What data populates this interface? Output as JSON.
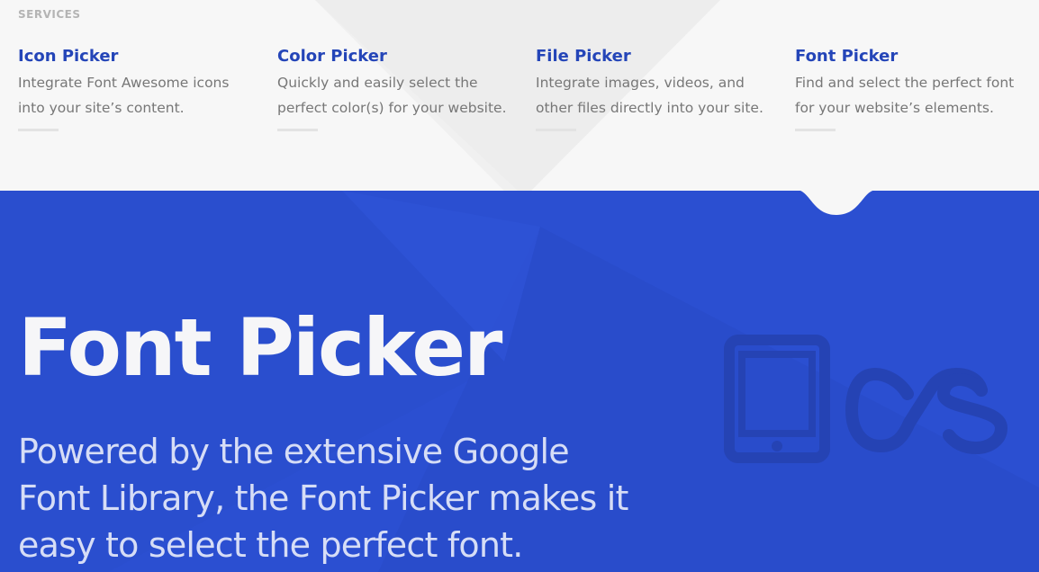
{
  "services": {
    "label": "SERVICES",
    "items": [
      {
        "title": "Icon Picker",
        "description": "Integrate Font Awesome icons into your site’s content."
      },
      {
        "title": "Color Picker",
        "description": "Quickly and easily select the perfect color(s) for your website."
      },
      {
        "title": "File Picker",
        "description": "Integrate images, videos, and other files directly into your site."
      },
      {
        "title": "Font Picker",
        "description": "Find and select the perfect font for your website’s elements."
      }
    ],
    "active_item": "Font Picker"
  },
  "hero": {
    "title": "Font Picker",
    "description": "Powered by the extensive Google Font Library, the Font Picker makes it easy to select the perfect font.",
    "icons": [
      "tablet-icon",
      "lastfm-icon"
    ]
  },
  "colors": {
    "accent": "#2445b8",
    "hero_background": "#2b4fd1",
    "page_background": "#f7f7f7",
    "description_text": "#777777"
  }
}
